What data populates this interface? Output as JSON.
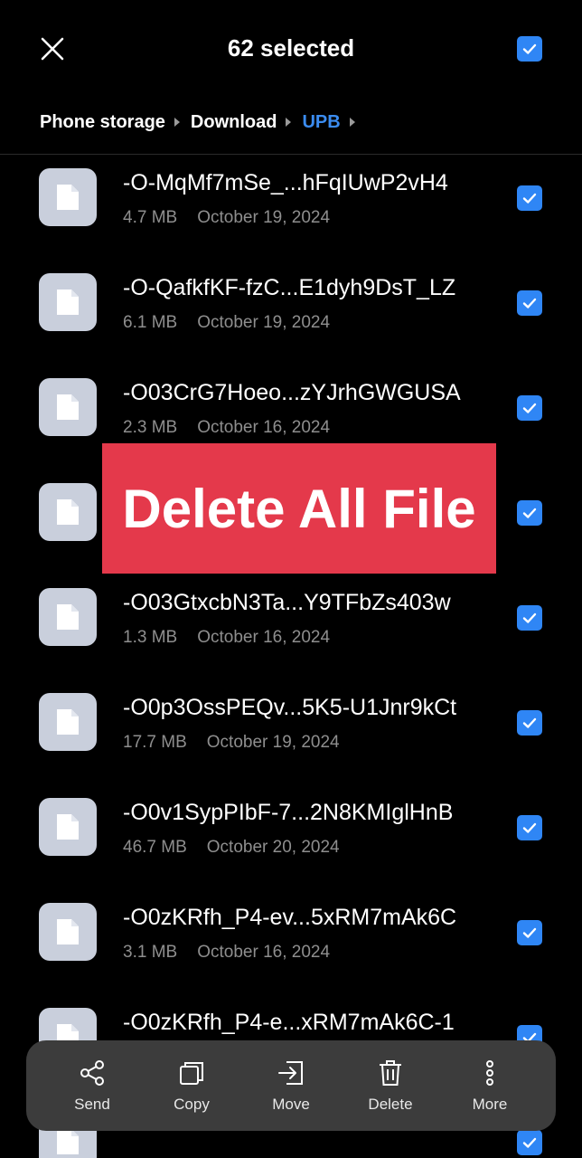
{
  "header": {
    "title": "62 selected",
    "close_icon": "close-icon",
    "select_all_checked": true
  },
  "breadcrumb": [
    "Phone storage",
    "Download",
    "UPB"
  ],
  "accent_color": "#2f86f5",
  "banner": {
    "text": "Delete All File",
    "color": "#e4394b"
  },
  "files": [
    {
      "name": "-O-MqMf7mSe_...hFqIUwP2vH4",
      "size": "4.7 MB",
      "date": "October 19, 2024"
    },
    {
      "name": "-O-QafkfKF-fzC...E1dyh9DsT_LZ",
      "size": "6.1 MB",
      "date": "October 19, 2024"
    },
    {
      "name": "-O03CrG7Hoeo...zYJrhGWGUSA",
      "size": "2.3 MB",
      "date": "October 16, 2024"
    },
    {
      "name": "",
      "size": "",
      "date": ""
    },
    {
      "name": "-O03GtxcbN3Ta...Y9TFbZs403w",
      "size": "1.3 MB",
      "date": "October 16, 2024"
    },
    {
      "name": "-O0p3OssPEQv...5K5-U1Jnr9kCt",
      "size": "17.7 MB",
      "date": "October 19, 2024"
    },
    {
      "name": "-O0v1SypPIbF-7...2N8KMIglHnB",
      "size": "46.7 MB",
      "date": "October 20, 2024"
    },
    {
      "name": "-O0zKRfh_P4-ev...5xRM7mAk6C",
      "size": "3.1 MB",
      "date": "October 16, 2024"
    },
    {
      "name": "-O0zKRfh_P4-e...xRM7mAk6C-1",
      "size": "",
      "date": ""
    }
  ],
  "actions": [
    {
      "label": "Send",
      "icon": "share-icon"
    },
    {
      "label": "Copy",
      "icon": "copy-icon"
    },
    {
      "label": "Move",
      "icon": "move-icon"
    },
    {
      "label": "Delete",
      "icon": "trash-icon"
    },
    {
      "label": "More",
      "icon": "more-vertical-icon"
    }
  ]
}
